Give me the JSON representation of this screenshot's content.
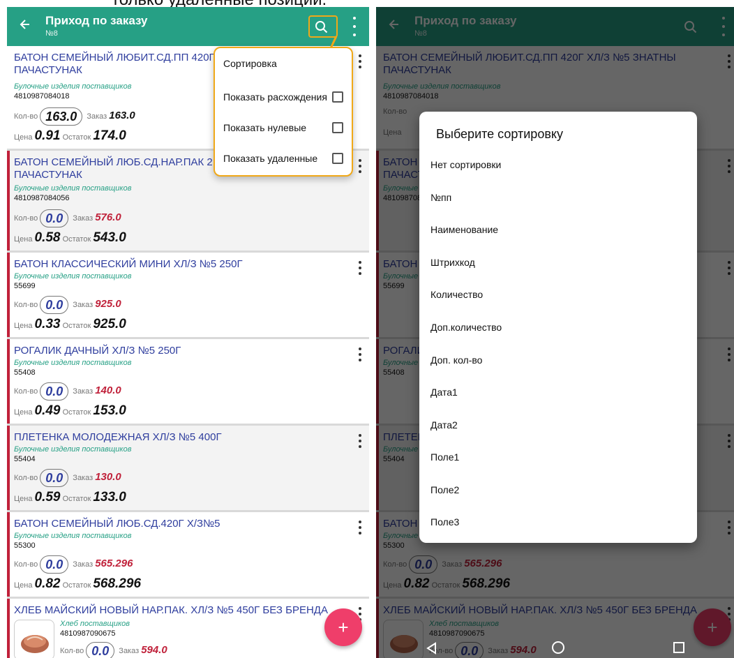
{
  "caption": "только удаленные позиции.",
  "appbar": {
    "back_icon": "arrow-left-icon",
    "title": "Приход по заказу",
    "subtitle": "№8"
  },
  "colors": {
    "appbar": "#26a085",
    "name": "#2f3e9e",
    "group": "#26a085",
    "accent_red": "#c0213a",
    "highlight": "#f0a818",
    "fab": "#ef3e6a"
  },
  "labels": {
    "qty": "Кол-во",
    "order": "Заказ",
    "price": "Цена",
    "rest": "Остаток",
    "fab": "+"
  },
  "items": [
    {
      "name": "БАТОН СЕМЕЙНЫЙ ЛЮБИТ.СД.ПП 420Г ХЛ/З №5 ЗНАТНЫ ПАЧАСТУНАК",
      "group": "Булочные изделия поставщиков",
      "code": "4810987084018",
      "qty": "163.0",
      "order": "163.0",
      "price": "0.91",
      "rest": "174.0"
    },
    {
      "name": "БАТОН СЕМЕЙНЫЙ ЛЮБ.СД.НАР.ПАК 2",
      "name2": "ПАЧАСТУНАК",
      "group": "Булочные изделия поставщиков",
      "code": "4810987084056",
      "qty": "0.0",
      "order": "576.0",
      "price": "0.58",
      "rest": "543.0"
    },
    {
      "name": "БАТОН КЛАССИЧЕСКИЙ МИНИ ХЛ/З №5 250Г",
      "group": "Булочные изделия поставщиков",
      "code": "55699",
      "qty": "0.0",
      "order": "925.0",
      "price": "0.33",
      "rest": "925.0"
    },
    {
      "name": "РОГАЛИК ДАЧНЫЙ ХЛ/З №5 250Г",
      "group": "Булочные изделия поставщиков",
      "code": "55408",
      "qty": "0.0",
      "order": "140.0",
      "price": "0.49",
      "rest": "153.0"
    },
    {
      "name": "ПЛЕТЕНКА МОЛОДЕЖНАЯ ХЛ/З №5 400Г",
      "group": "Булочные изделия поставщиков",
      "code": "55404",
      "qty": "0.0",
      "order": "130.0",
      "price": "0.59",
      "rest": "133.0"
    },
    {
      "name": "БАТОН СЕМЕЙНЫЙ ЛЮБ.СД.420Г Х/З№5",
      "group": "Булочные изделия поставщиков",
      "code": "55300",
      "qty": "0.0",
      "order": "565.296",
      "price": "0.82",
      "rest": "568.296"
    },
    {
      "name": "ХЛЕБ МАЙСКИЙ НОВЫЙ НАР.ПАК. ХЛ/З №5 450Г БЕЗ БРЕНДА",
      "group": "Хлеб поставщиков",
      "code": "4810987090675",
      "qty": "0.0",
      "order": "594.0"
    }
  ],
  "menu": {
    "sort": "Сортировка",
    "show_diff": "Показать расхождения",
    "show_zero": "Показать нулевые",
    "show_deleted": "Показать удаленные"
  },
  "dialog": {
    "title": "Выберите сортировку",
    "options": [
      "Нет сортировки",
      "№пп",
      "Наименование",
      "Штрихкод",
      "Количество",
      "Доп.количество",
      "Доп. кол-во",
      "Дата1",
      "Дата2",
      "Поле1",
      "Поле2",
      "Поле3"
    ]
  }
}
